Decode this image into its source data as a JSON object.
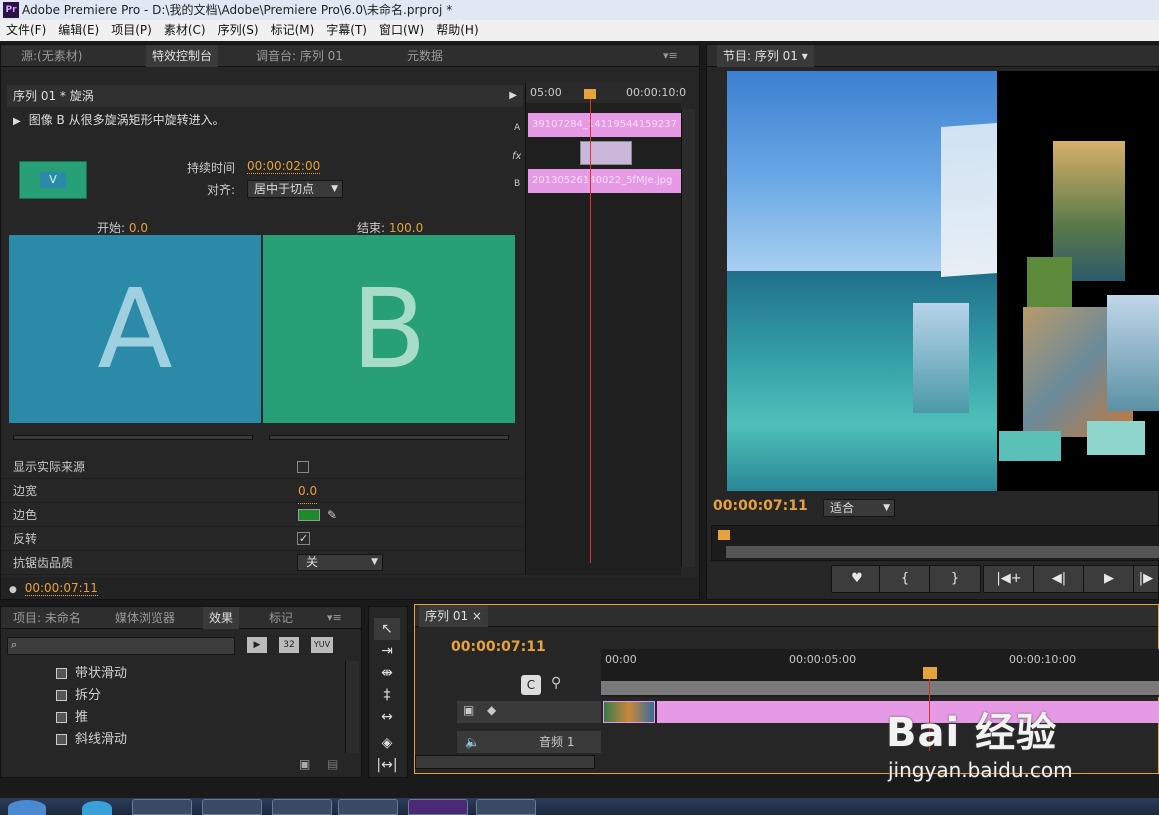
{
  "window": {
    "title": "Adobe Premiere Pro - D:\\我的文档\\Adobe\\Premiere Pro\\6.0\\未命名.prproj *",
    "app_badge": "Pr"
  },
  "menu": [
    "文件(F)",
    "编辑(E)",
    "项目(P)",
    "素材(C)",
    "序列(S)",
    "标记(M)",
    "字幕(T)",
    "窗口(W)",
    "帮助(H)"
  ],
  "source_panel": {
    "tabs": [
      "源:(无素材)",
      "特效控制台",
      "调音台: 序列 01",
      "元数据"
    ],
    "header": "序列 01 * 旋涡",
    "description": "图像 B 从很多旋涡矩形中旋转进入。",
    "duration_label": "持续时间",
    "duration_value": "00:00:02:00",
    "align_label": "对齐:",
    "align_value": "居中于切点",
    "start_label": "开始:",
    "start_value": "0.0",
    "end_label": "结束:",
    "end_value": "100.0",
    "preview_a": "A",
    "preview_b": "B",
    "thumb_letter": "V",
    "props": [
      {
        "label": "显示实际来源",
        "value": ""
      },
      {
        "label": "边宽",
        "value": "0.0"
      },
      {
        "label": "边色",
        "value": ""
      },
      {
        "label": "反转",
        "value": "✓"
      },
      {
        "label": "抗锯齿品质",
        "value": "关"
      }
    ],
    "timecode": "00:00:07:11",
    "mini_timeline": {
      "ruler_left": "05:00",
      "ruler_right": "00:00:10:0",
      "track_a_label": "A",
      "track_b_label": "B",
      "fx_label": "fx",
      "clip_a": "39107284_14119544159237",
      "clip_b": "20130526140022_5fMJe.jpg"
    }
  },
  "program_panel": {
    "title": "节目: 序列 01",
    "timecode": "00:00:07:11",
    "zoom": "适合"
  },
  "transport": [
    "♥",
    "{",
    "}",
    "|◀+",
    "◀|",
    "▶",
    "|▶"
  ],
  "project_panel": {
    "tabs": [
      "项目: 未命名",
      "媒体浏览器",
      "效果",
      "标记"
    ],
    "search_placeholder": "",
    "badges": [
      "32",
      "YUV"
    ],
    "effects": [
      "带状滑动",
      "拆分",
      "推",
      "斜线滑动"
    ]
  },
  "timeline": {
    "tab": "序列 01",
    "timecode": "00:00:07:11",
    "ruler": [
      "00:00",
      "00:00:05:00",
      "00:00:10:00"
    ],
    "audio_track": "音频 1"
  },
  "watermark": {
    "brand": "Bai 经验",
    "url": "jingyan.baidu.com"
  },
  "colors": {
    "accent": "#e6a23c",
    "clip": "#e69ae6",
    "playhead": "#e0302a",
    "preview_a": "#2a8aa8",
    "preview_b": "#27a078"
  }
}
